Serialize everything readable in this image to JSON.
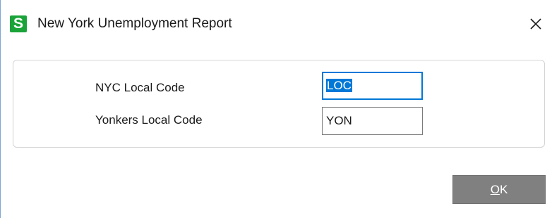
{
  "window": {
    "title": "New York Unemployment Report",
    "app_icon_letter": "S",
    "app_icon_color": "#1aa338",
    "close_icon": "close-icon"
  },
  "form": {
    "nyc_label": "NYC Local Code",
    "nyc_value": "LOC",
    "yonkers_label": "Yonkers Local Code",
    "yonkers_value": "YON"
  },
  "buttons": {
    "ok_mnemonic": "O",
    "ok_rest": "K"
  },
  "colors": {
    "focus_accent": "#0078d7",
    "button_bg": "#808080"
  }
}
